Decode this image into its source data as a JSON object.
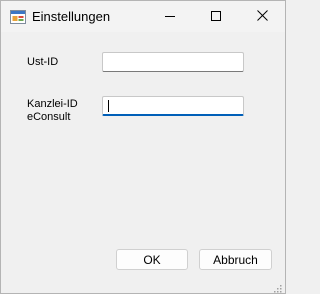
{
  "window": {
    "title": "Einstellungen",
    "app_icon": "form-window-icon",
    "minimize_icon": "minimize-icon",
    "maximize_icon": "maximize-icon",
    "close_icon": "close-icon"
  },
  "form": {
    "ust_id": {
      "label": "Ust-ID",
      "value": ""
    },
    "kanzlei_id": {
      "label_line1": "Kanzlei-ID",
      "label_line2": "eConsult",
      "value": ""
    }
  },
  "buttons": {
    "ok_label": "OK",
    "cancel_label": "Abbruch"
  },
  "colors": {
    "focus_accent": "#005fb8",
    "window_background": "#f0f0f0"
  }
}
